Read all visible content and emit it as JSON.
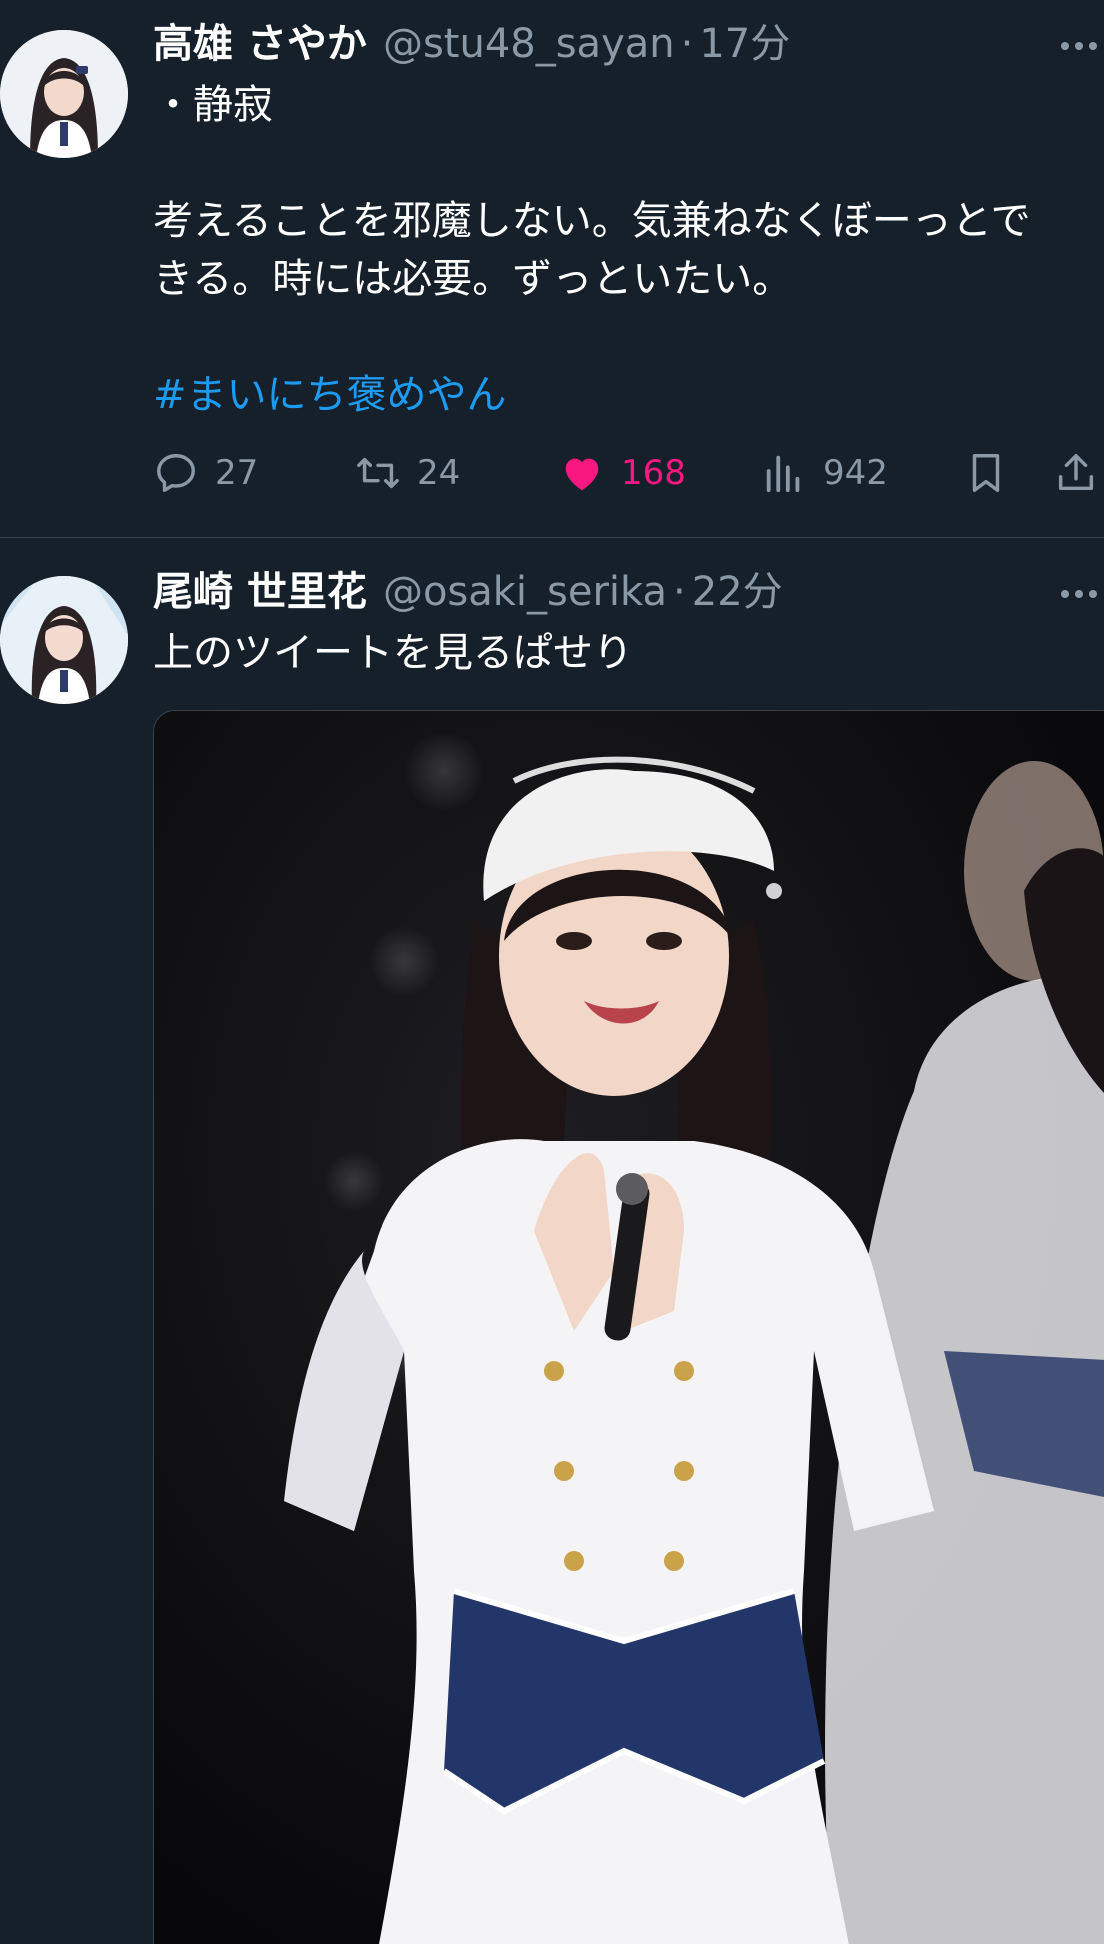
{
  "tweets": [
    {
      "display_name": "高雄 さやか",
      "handle": "@stu48_sayan",
      "separator": "·",
      "time": "17分",
      "text": "・静寂\n\n考えることを邪魔しない。気兼ねなくぼーっとで\nきる。時には必要。ずっといたい。",
      "hashtag": "#まいにち褒めやん",
      "stats": {
        "replies": "27",
        "retweets": "24",
        "likes": "168",
        "views": "942"
      },
      "liked": true
    },
    {
      "display_name": "尾崎 世里花",
      "handle": "@osaki_serika",
      "separator": "·",
      "time": "22分",
      "text": "上のツイートを見るぱせり"
    }
  ],
  "icons": {
    "reply": "reply-icon",
    "retweet": "retweet-icon",
    "like": "heart-icon",
    "views": "views-icon",
    "bookmark": "bookmark-icon",
    "share": "share-icon",
    "more": "more-icon"
  },
  "colors": {
    "background": "#15202b",
    "secondary_text": "#8b98a5",
    "hashtag": "#1d9bf0",
    "like": "#f91880",
    "divider": "#38444d"
  }
}
